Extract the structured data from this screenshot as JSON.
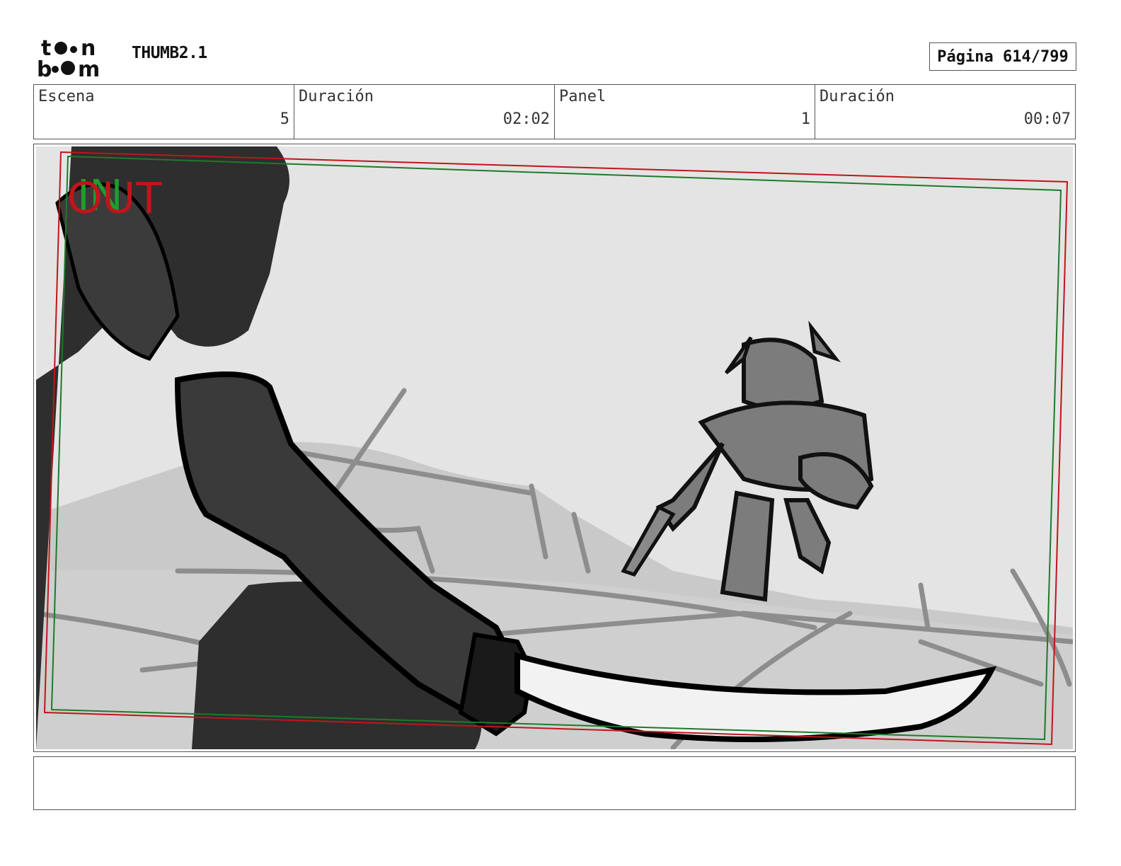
{
  "header": {
    "logo_text": "toon boom",
    "project_title": "THUMB2.1",
    "page_label": "Página 614/799"
  },
  "info": {
    "scene_label": "Escena",
    "scene_value": "5",
    "scene_duration_label": "Duración",
    "scene_duration_value": "02:02",
    "panel_label": "Panel",
    "panel_value": "1",
    "panel_duration_label": "Duración",
    "panel_duration_value": "00:07"
  },
  "panel": {
    "in_marker": "IN",
    "out_marker": "OUT",
    "in_color": "#1f9e2e",
    "out_color": "#c0151b"
  },
  "notes": {
    "text": ""
  }
}
